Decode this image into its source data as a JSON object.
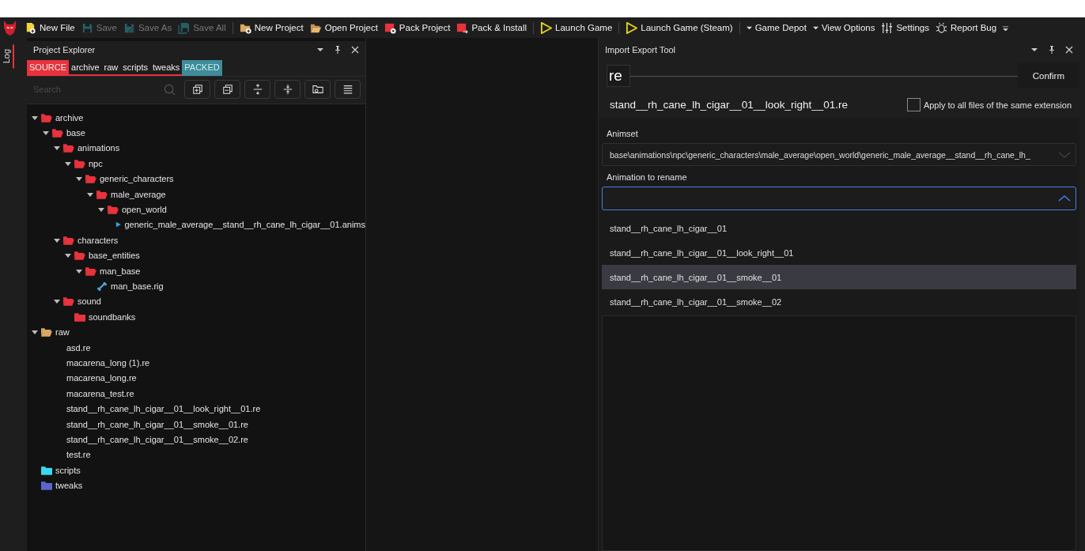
{
  "toolbar": {
    "groups": [
      [
        {
          "kind": "new-file",
          "label": "New File",
          "disabled": false
        },
        {
          "kind": "save",
          "label": "Save",
          "disabled": true
        },
        {
          "kind": "save-as",
          "label": "Save As",
          "disabled": true
        },
        {
          "kind": "save-all",
          "label": "Save All",
          "disabled": true
        }
      ],
      [
        {
          "kind": "new-project",
          "label": "New Project",
          "disabled": false
        },
        {
          "kind": "open-project",
          "label": "Open Project",
          "disabled": false
        },
        {
          "kind": "pack-project",
          "label": "Pack Project",
          "disabled": false
        },
        {
          "kind": "pack-install",
          "label": "Pack & Install",
          "disabled": false
        }
      ],
      [
        {
          "kind": "launch",
          "label": "Launch Game",
          "disabled": false
        }
      ],
      [
        {
          "kind": "launch",
          "label": "Launch Game (Steam)",
          "disabled": false
        }
      ],
      [
        {
          "kind": "dropdown",
          "label": "Game Depot",
          "disabled": false
        },
        {
          "kind": "dropdown",
          "label": "View Options",
          "disabled": false
        },
        {
          "kind": "settings",
          "label": "Settings",
          "disabled": false
        },
        {
          "kind": "bug",
          "label": "Report Bug",
          "disabled": false
        }
      ]
    ]
  },
  "side_tab": {
    "label": "Log"
  },
  "project_explorer": {
    "title": "Project Explorer",
    "tabs": [
      {
        "label": "SOURCE",
        "kind": "filter",
        "selected": true
      },
      {
        "label": "archive",
        "kind": "filter",
        "selected": false
      },
      {
        "label": "raw",
        "kind": "filter",
        "selected": false
      },
      {
        "label": "scripts",
        "kind": "filter",
        "selected": false
      },
      {
        "label": "tweaks",
        "kind": "filter",
        "selected": false
      },
      {
        "label": "PACKED",
        "kind": "toggle",
        "selected": true
      }
    ],
    "search": {
      "placeholder": "Search"
    },
    "tree": [
      {
        "name": "archive",
        "kind": "folder",
        "color": "#e8323c",
        "children": [
          {
            "name": "base",
            "kind": "folder",
            "color": "#e8323c",
            "children": [
              {
                "name": "animations",
                "kind": "folder",
                "color": "#e8323c",
                "children": [
                  {
                    "name": "npc",
                    "kind": "folder",
                    "color": "#e8323c",
                    "children": [
                      {
                        "name": "generic_characters",
                        "kind": "folder",
                        "color": "#e8323c",
                        "children": [
                          {
                            "name": "male_average",
                            "kind": "folder",
                            "color": "#e8323c",
                            "children": [
                              {
                                "name": "open_world",
                                "kind": "folder",
                                "color": "#e8323c",
                                "children": [
                                  {
                                    "name": "generic_male_average__stand__rh_cane_lh_cigar__01.anims",
                                    "kind": "anims"
                                  }
                                ]
                              }
                            ]
                          }
                        ]
                      }
                    ]
                  }
                ]
              },
              {
                "name": "characters",
                "kind": "folder",
                "color": "#e8323c",
                "children": [
                  {
                    "name": "base_entities",
                    "kind": "folder",
                    "color": "#e8323c",
                    "children": [
                      {
                        "name": "man_base",
                        "kind": "folder",
                        "color": "#e8323c",
                        "children": [
                          {
                            "name": "man_base.rig",
                            "kind": "rig"
                          }
                        ]
                      }
                    ]
                  }
                ]
              },
              {
                "name": "sound",
                "kind": "folder",
                "color": "#e8323c",
                "children": [
                  {
                    "name": "soundbanks",
                    "kind": "folder",
                    "color": "#e8323c"
                  }
                ]
              }
            ]
          }
        ]
      },
      {
        "name": "raw",
        "kind": "folder",
        "color": "#d8a864",
        "children": [
          {
            "name": "asd.re",
            "kind": "file"
          },
          {
            "name": "macarena_long (1).re",
            "kind": "file"
          },
          {
            "name": "macarena_long.re",
            "kind": "file"
          },
          {
            "name": "macarena_test.re",
            "kind": "file"
          },
          {
            "name": "stand__rh_cane_lh_cigar__01__look_right__01.re",
            "kind": "file"
          },
          {
            "name": "stand__rh_cane_lh_cigar__01__smoke__01.re",
            "kind": "file"
          },
          {
            "name": "stand__rh_cane_lh_cigar__01__smoke__02.re",
            "kind": "file"
          },
          {
            "name": "test.re",
            "kind": "file"
          }
        ]
      },
      {
        "name": "scripts",
        "kind": "folder",
        "color": "#3ad8f0"
      },
      {
        "name": "tweaks",
        "kind": "folder",
        "color": "#5a66d0"
      }
    ]
  },
  "import_export_tool": {
    "title": "Import Export Tool",
    "extension": "re",
    "confirm": "Confirm",
    "file_name": "stand__rh_cane_lh_cigar__01__look_right__01.re",
    "apply_all": {
      "label": "Apply to all files of the same extension",
      "checked": false
    },
    "animset_label": "Animset",
    "animset_value": "base\\animations\\npc\\generic_characters\\male_average\\open_world\\generic_male_average__stand__rh_cane_lh_",
    "rename_label": "Animation to rename",
    "rename_open": true,
    "options": [
      {
        "label": "stand__rh_cane_lh_cigar__01",
        "selected": false
      },
      {
        "label": "stand__rh_cane_lh_cigar__01__look_right__01",
        "selected": false
      },
      {
        "label": "stand__rh_cane_lh_cigar__01__smoke__01",
        "selected": true
      },
      {
        "label": "stand__rh_cane_lh_cigar__01__smoke__02",
        "selected": false
      }
    ]
  }
}
